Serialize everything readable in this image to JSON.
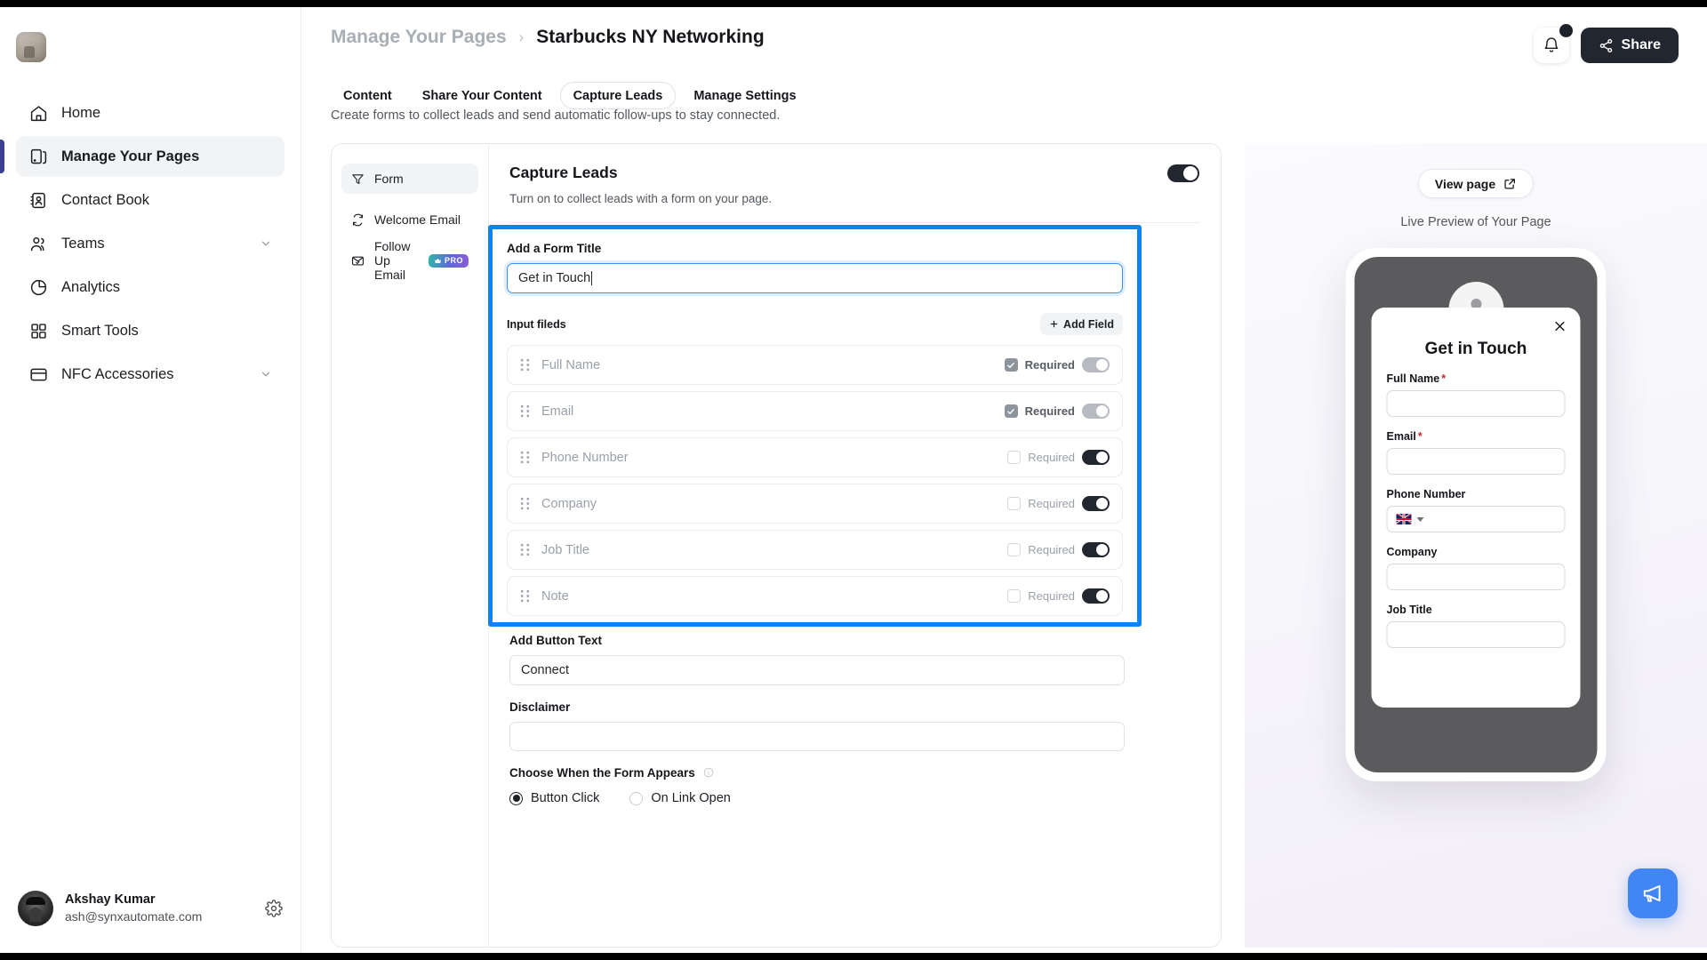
{
  "sidebar": {
    "logo_name": "workspace-logo",
    "items": [
      {
        "label": "Home",
        "icon": "home-icon",
        "expandable": false
      },
      {
        "label": "Manage Your Pages",
        "icon": "pages-icon",
        "expandable": false
      },
      {
        "label": "Contact Book",
        "icon": "contact-book-icon",
        "expandable": false
      },
      {
        "label": "Teams",
        "icon": "teams-icon",
        "expandable": true
      },
      {
        "label": "Analytics",
        "icon": "analytics-icon",
        "expandable": false
      },
      {
        "label": "Smart Tools",
        "icon": "smart-tools-icon",
        "expandable": false
      },
      {
        "label": "NFC Accessories",
        "icon": "nfc-card-icon",
        "expandable": true
      }
    ],
    "user": {
      "name": "Akshay Kumar",
      "email": "ash@synxautomate.com"
    }
  },
  "header": {
    "breadcrumb_parent": "Manage Your Pages",
    "breadcrumb_sep": "›",
    "breadcrumb_current": "Starbucks NY Networking",
    "share_label": "Share"
  },
  "tabs": [
    {
      "label": "Content",
      "active": false
    },
    {
      "label": "Share Your Content",
      "active": false
    },
    {
      "label": "Capture Leads",
      "active": true
    },
    {
      "label": "Manage Settings",
      "active": false
    }
  ],
  "page_subtitle": "Create forms to collect leads and send automatic follow-ups to stay connected.",
  "card_nav": [
    {
      "label": "Form",
      "icon": "filter-icon",
      "active": true,
      "badge": null
    },
    {
      "label": "Welcome Email",
      "icon": "refresh-icon",
      "active": false,
      "badge": null
    },
    {
      "label": "Follow Up Email",
      "icon": "mail-check-icon",
      "active": false,
      "badge": "PRO"
    }
  ],
  "capture_leads": {
    "title": "Capture Leads",
    "description": "Turn on to collect leads with a form on your page.",
    "enabled": true
  },
  "form": {
    "title_label": "Add a Form Title",
    "title_value": "Get in Touch",
    "input_fields_label": "Input fileds",
    "add_field_label": "Add Field",
    "required_label": "Required",
    "fields": [
      {
        "name": "Full Name",
        "required": true,
        "locked": true,
        "enabled": true
      },
      {
        "name": "Email",
        "required": true,
        "locked": true,
        "enabled": true
      },
      {
        "name": "Phone Number",
        "required": false,
        "locked": false,
        "enabled": true
      },
      {
        "name": "Company",
        "required": false,
        "locked": false,
        "enabled": true
      },
      {
        "name": "Job Title",
        "required": false,
        "locked": false,
        "enabled": true
      },
      {
        "name": "Note",
        "required": false,
        "locked": false,
        "enabled": true
      }
    ],
    "button_text_label": "Add Button Text",
    "button_text_value": "Connect",
    "disclaimer_label": "Disclaimer",
    "disclaimer_value": "",
    "appears_label": "Choose When the Form Appears",
    "appears_options": [
      {
        "label": "Button Click",
        "selected": true
      },
      {
        "label": "On Link Open",
        "selected": false
      }
    ]
  },
  "preview": {
    "view_page_label": "View page",
    "caption": "Live Preview of Your Page",
    "form_title": "Get in Touch",
    "fields": [
      {
        "label": "Full Name",
        "required": true,
        "type": "text"
      },
      {
        "label": "Email",
        "required": true,
        "type": "text"
      },
      {
        "label": "Phone Number",
        "required": false,
        "type": "phone"
      },
      {
        "label": "Company",
        "required": false,
        "type": "text"
      },
      {
        "label": "Job Title",
        "required": false,
        "type": "text"
      }
    ],
    "required_marker": "*",
    "phone_country_flag": "uk-flag-icon"
  },
  "colors": {
    "focus_blue": "#0d83f5",
    "dark": "#22262f",
    "chat_blue": "#4285f4",
    "accent_purple": "#3b3f8f"
  }
}
